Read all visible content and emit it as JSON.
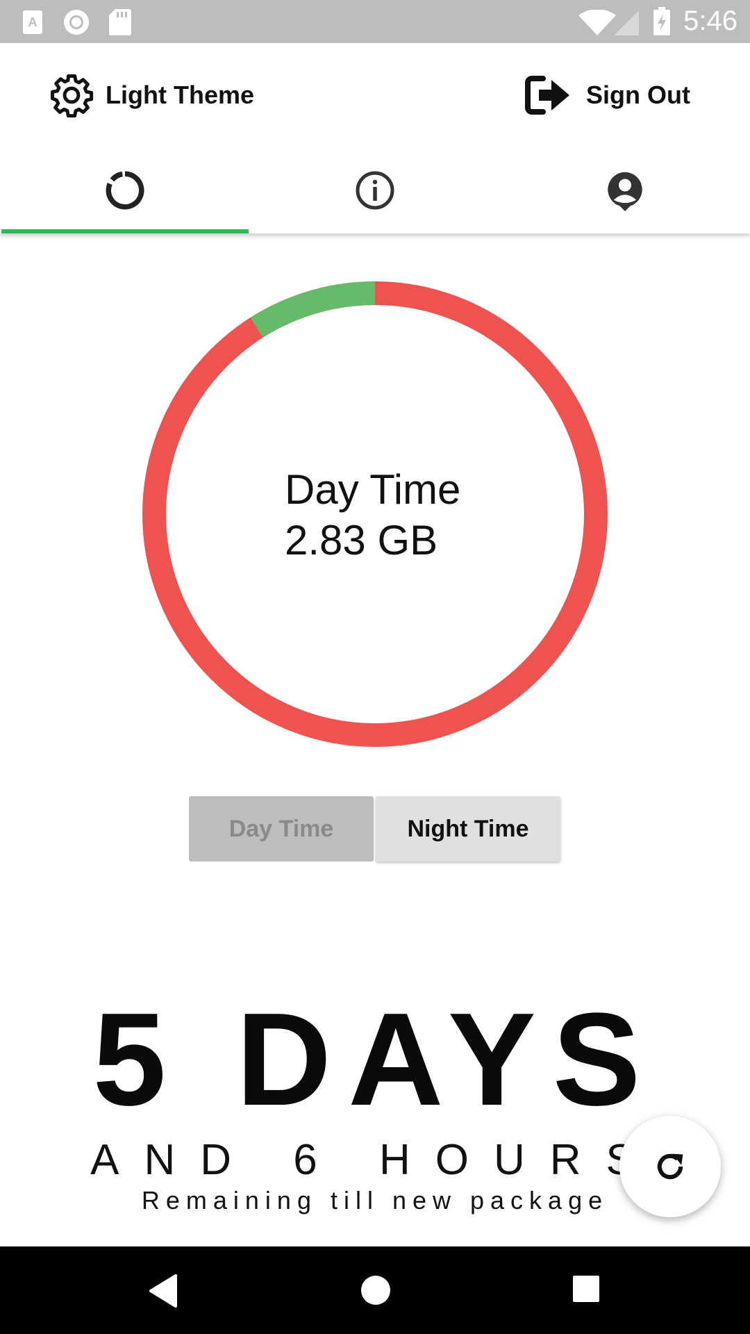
{
  "status_bar": {
    "time": "5:46",
    "icons": [
      "app-a-icon",
      "record-icon",
      "sd-card-icon",
      "wifi-icon",
      "signal-icon",
      "battery-charging-icon"
    ]
  },
  "topbar": {
    "theme_label": "Light Theme",
    "theme_icon": "gear-icon",
    "signout_label": "Sign Out",
    "signout_icon": "sign-out-icon"
  },
  "tabs": [
    {
      "icon": "usage-donut-icon",
      "selected": true
    },
    {
      "icon": "info-icon",
      "selected": false
    },
    {
      "icon": "account-icon",
      "selected": false
    }
  ],
  "colors": {
    "accent_green": "#2eb85c",
    "used_red": "#ef5350",
    "remaining_green": "#66bb6a"
  },
  "usage": {
    "title": "Day Time",
    "value": "2.83 GB",
    "remaining_fraction": 0.09
  },
  "toggle": {
    "day_label": "Day Time",
    "night_label": "Night Time",
    "selected": "day"
  },
  "countdown": {
    "days": "5 DAYS",
    "hours": "AND 6 HOURS",
    "caption": "Remaining till new package"
  },
  "fab": {
    "icon": "refresh-icon"
  },
  "navbar": {
    "icons": [
      "back-icon",
      "home-icon",
      "recents-icon"
    ]
  }
}
